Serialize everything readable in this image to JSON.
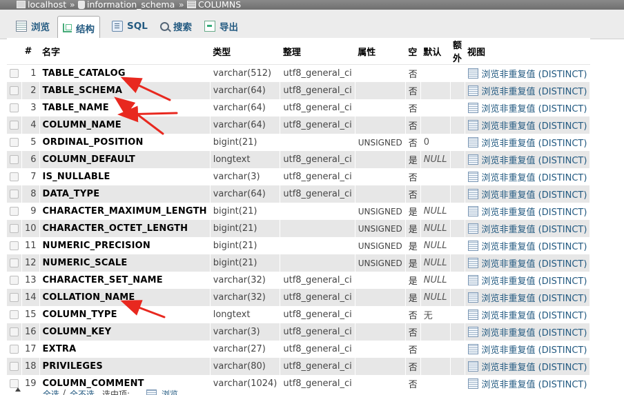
{
  "breadcrumb": {
    "server": "localhost",
    "database": "information_schema",
    "table": "COLUMNS",
    "separator": "»"
  },
  "tabs": [
    {
      "label": "浏览",
      "icon": "browse-icon"
    },
    {
      "label": "结构",
      "icon": "structure-icon",
      "active": true
    },
    {
      "label": "SQL",
      "icon": "sql-icon"
    },
    {
      "label": "搜索",
      "icon": "search-icon"
    },
    {
      "label": "导出",
      "icon": "export-icon"
    }
  ],
  "table": {
    "headers": [
      "#",
      "名字",
      "类型",
      "整理",
      "属性",
      "空",
      "默认",
      "额外",
      "视图"
    ],
    "view_label": "浏览非重复值 (DISTINCT)",
    "rows": [
      {
        "num": "1",
        "name": "TABLE_CATALOG",
        "type": "varchar(512)",
        "collation": "utf8_general_ci",
        "attr": "",
        "null": "否",
        "default": ""
      },
      {
        "num": "2",
        "name": "TABLE_SCHEMA",
        "type": "varchar(64)",
        "collation": "utf8_general_ci",
        "attr": "",
        "null": "否",
        "default": ""
      },
      {
        "num": "3",
        "name": "TABLE_NAME",
        "type": "varchar(64)",
        "collation": "utf8_general_ci",
        "attr": "",
        "null": "否",
        "default": ""
      },
      {
        "num": "4",
        "name": "COLUMN_NAME",
        "type": "varchar(64)",
        "collation": "utf8_general_ci",
        "attr": "",
        "null": "否",
        "default": ""
      },
      {
        "num": "5",
        "name": "ORDINAL_POSITION",
        "type": "bigint(21)",
        "collation": "",
        "attr": "UNSIGNED",
        "null": "否",
        "default": "0"
      },
      {
        "num": "6",
        "name": "COLUMN_DEFAULT",
        "type": "longtext",
        "collation": "utf8_general_ci",
        "attr": "",
        "null": "是",
        "default": "NULL"
      },
      {
        "num": "7",
        "name": "IS_NULLABLE",
        "type": "varchar(3)",
        "collation": "utf8_general_ci",
        "attr": "",
        "null": "否",
        "default": ""
      },
      {
        "num": "8",
        "name": "DATA_TYPE",
        "type": "varchar(64)",
        "collation": "utf8_general_ci",
        "attr": "",
        "null": "否",
        "default": ""
      },
      {
        "num": "9",
        "name": "CHARACTER_MAXIMUM_LENGTH",
        "type": "bigint(21)",
        "collation": "",
        "attr": "UNSIGNED",
        "null": "是",
        "default": "NULL"
      },
      {
        "num": "10",
        "name": "CHARACTER_OCTET_LENGTH",
        "type": "bigint(21)",
        "collation": "",
        "attr": "UNSIGNED",
        "null": "是",
        "default": "NULL"
      },
      {
        "num": "11",
        "name": "NUMERIC_PRECISION",
        "type": "bigint(21)",
        "collation": "",
        "attr": "UNSIGNED",
        "null": "是",
        "default": "NULL"
      },
      {
        "num": "12",
        "name": "NUMERIC_SCALE",
        "type": "bigint(21)",
        "collation": "",
        "attr": "UNSIGNED",
        "null": "是",
        "default": "NULL"
      },
      {
        "num": "13",
        "name": "CHARACTER_SET_NAME",
        "type": "varchar(32)",
        "collation": "utf8_general_ci",
        "attr": "",
        "null": "是",
        "default": "NULL"
      },
      {
        "num": "14",
        "name": "COLLATION_NAME",
        "type": "varchar(32)",
        "collation": "utf8_general_ci",
        "attr": "",
        "null": "是",
        "default": "NULL"
      },
      {
        "num": "15",
        "name": "COLUMN_TYPE",
        "type": "longtext",
        "collation": "utf8_general_ci",
        "attr": "",
        "null": "否",
        "default": "无"
      },
      {
        "num": "16",
        "name": "COLUMN_KEY",
        "type": "varchar(3)",
        "collation": "utf8_general_ci",
        "attr": "",
        "null": "否",
        "default": ""
      },
      {
        "num": "17",
        "name": "EXTRA",
        "type": "varchar(27)",
        "collation": "utf8_general_ci",
        "attr": "",
        "null": "否",
        "default": ""
      },
      {
        "num": "18",
        "name": "PRIVILEGES",
        "type": "varchar(80)",
        "collation": "utf8_general_ci",
        "attr": "",
        "null": "否",
        "default": ""
      },
      {
        "num": "19",
        "name": "COLUMN_COMMENT",
        "type": "varchar(1024)",
        "collation": "utf8_general_ci",
        "attr": "",
        "null": "否",
        "default": ""
      }
    ]
  },
  "bottom": {
    "check_all": "全选",
    "separator": "/",
    "uncheck_all": "全不选",
    "with_selected": "选中项:",
    "browse": "浏览"
  },
  "colors": {
    "accent": "#235a81",
    "row_alt": "#e7e7e7",
    "arrow": "#e8281f"
  }
}
